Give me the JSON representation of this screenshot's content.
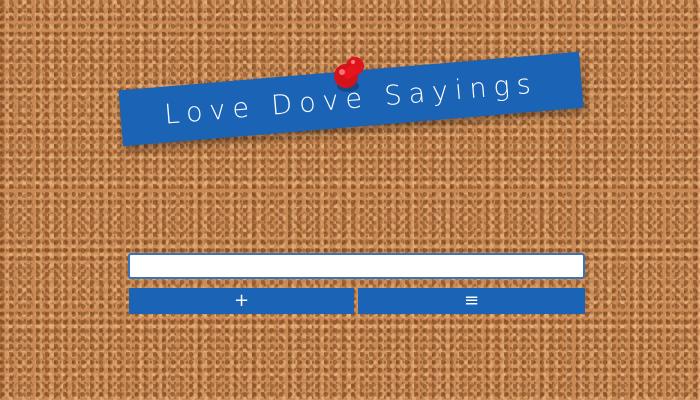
{
  "header": {
    "title": "Love Dove Sayings",
    "pin_icon": "pushpin-icon",
    "banner_color": "#1a63b5",
    "pin_color": "#e0141b"
  },
  "form": {
    "input_value": "",
    "input_placeholder": "",
    "add_button_label": "+",
    "list_button_label": "≡"
  }
}
